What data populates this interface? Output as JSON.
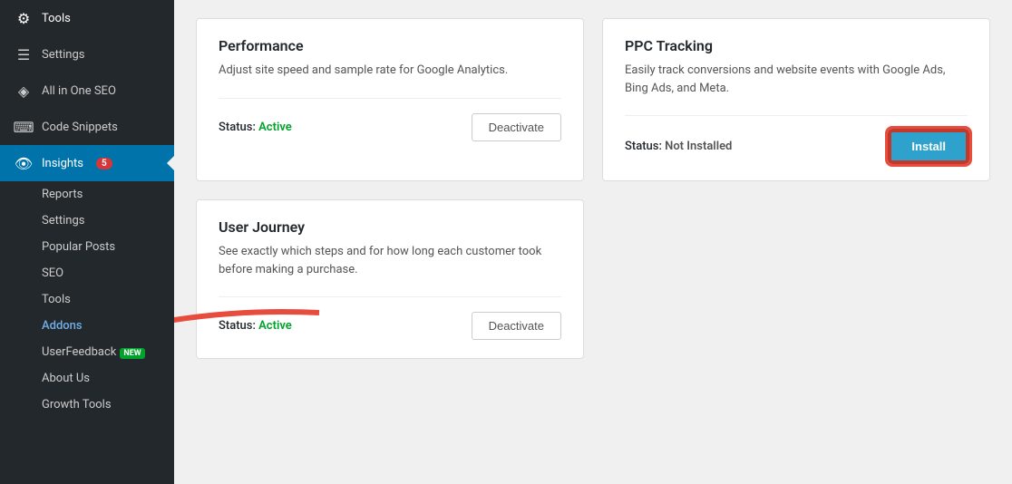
{
  "sidebar": {
    "items": [
      {
        "id": "tools",
        "label": "Tools",
        "icon": "🔧",
        "active": false
      },
      {
        "id": "settings",
        "label": "Settings",
        "icon": "⚙",
        "active": false
      },
      {
        "id": "allinoneseo",
        "label": "All in One SEO",
        "icon": "◈",
        "active": false
      },
      {
        "id": "codesnippets",
        "label": "Code Snippets",
        "icon": "⌨",
        "active": false
      },
      {
        "id": "insights",
        "label": "Insights",
        "icon": "👁",
        "active": true,
        "badge": "5"
      }
    ],
    "submenu": [
      {
        "id": "reports",
        "label": "Reports"
      },
      {
        "id": "settings",
        "label": "Settings"
      },
      {
        "id": "popular-posts",
        "label": "Popular Posts"
      },
      {
        "id": "seo",
        "label": "SEO"
      },
      {
        "id": "tools",
        "label": "Tools"
      },
      {
        "id": "addons",
        "label": "Addons",
        "highlight": true
      },
      {
        "id": "userfeedback",
        "label": "UserFeedback",
        "new_badge": "NEW"
      },
      {
        "id": "about-us",
        "label": "About Us"
      },
      {
        "id": "growth-tools",
        "label": "Growth Tools"
      }
    ]
  },
  "cards": [
    {
      "id": "performance",
      "title": "Performance",
      "description": "Adjust site speed and sample rate for Google Analytics.",
      "status_label": "Status:",
      "status_value": "Active",
      "status_type": "active",
      "button_label": "Deactivate",
      "button_type": "deactivate"
    },
    {
      "id": "ppc-tracking",
      "title": "PPC Tracking",
      "description": "Easily track conversions and website events with Google Ads, Bing Ads, and Meta.",
      "status_label": "Status:",
      "status_value": "Not Installed",
      "status_type": "not-installed",
      "button_label": "Install",
      "button_type": "install"
    },
    {
      "id": "user-journey",
      "title": "User Journey",
      "description": "See exactly which steps and for how long each customer took before making a purchase.",
      "status_label": "Status:",
      "status_value": "Active",
      "status_type": "active",
      "button_label": "Deactivate",
      "button_type": "deactivate"
    }
  ]
}
